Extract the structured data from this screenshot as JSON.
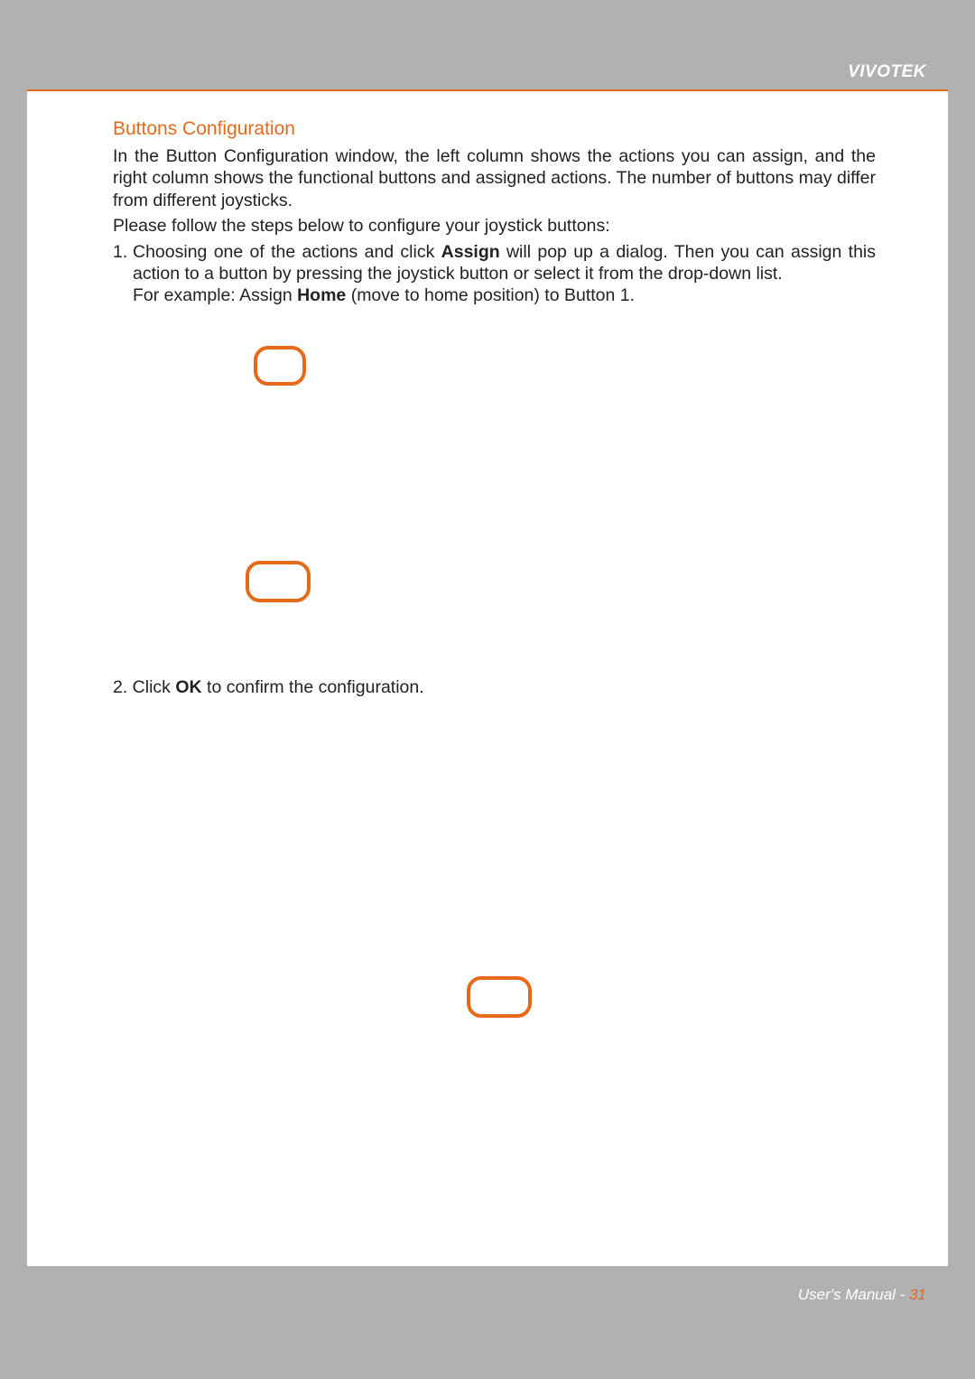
{
  "brand": "VIVOTEK",
  "section_title": "Buttons Configuration",
  "intro": "In the Button Configuration window, the left column shows the actions you can assign, and the right column shows the functional buttons and assigned actions. The number of buttons may differ from different joysticks.",
  "please_follow": "Please follow the steps below to configure your joystick buttons:",
  "step1": {
    "num": "1.",
    "pre_assign": "Choosing one of the actions and click ",
    "assign": "Assign",
    "post_assign": " will pop up a dialog. Then you can assign this action to a button by pressing the joystick button or select it from the drop-down list.",
    "example_pre": "For example: Assign ",
    "example_bold": "Home",
    "example_post": " (move to home position) to Button 1."
  },
  "step2": {
    "pre": "2. Click ",
    "ok": "OK",
    "post": " to confirm the configuration."
  },
  "footer": {
    "label": "User's Manual - ",
    "page": "31"
  }
}
